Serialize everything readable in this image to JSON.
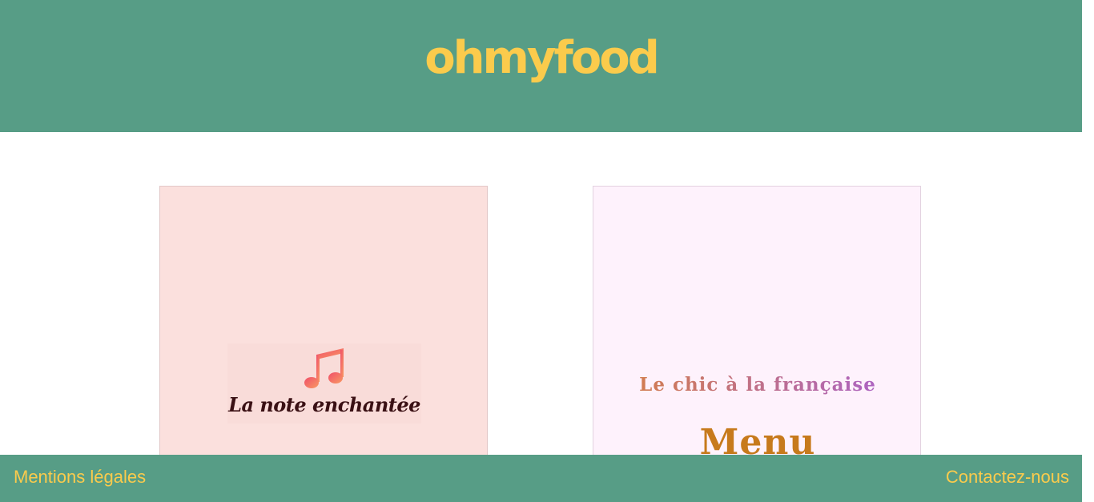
{
  "header": {
    "logo_text": "ohmyfood"
  },
  "cards": [
    {
      "name": "La note enchantée",
      "icon": "music-note-icon"
    },
    {
      "tagline": "Le chic à la française",
      "heading": "Menu"
    }
  ],
  "footer": {
    "legal_label": "Mentions légales",
    "contact_label": "Contactez-nous"
  },
  "colors": {
    "brand_green": "#579d86",
    "brand_yellow": "#fbcb4c",
    "card_pink": "#fbe0dd",
    "card_lilac": "#fef2fc"
  }
}
